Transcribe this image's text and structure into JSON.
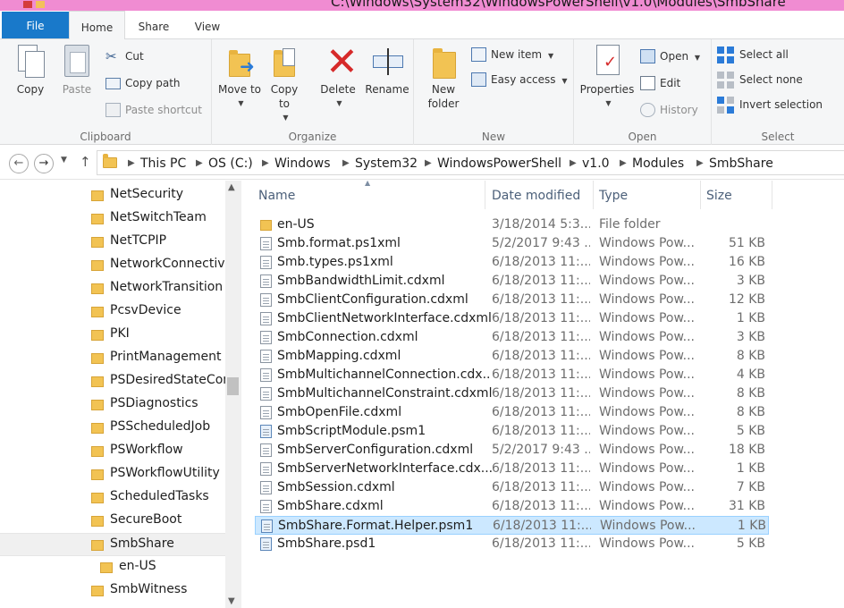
{
  "window": {
    "title": "C:\\Windows\\System32\\WindowsPowerShell\\v1.0\\Modules\\SmbShare"
  },
  "ribbon_tabs": [
    "File",
    "Home",
    "Share",
    "View"
  ],
  "ribbon": {
    "clipboard": {
      "label": "Clipboard",
      "copy": "Copy",
      "paste": "Paste",
      "cut": "Cut",
      "copy_path": "Copy path",
      "paste_shortcut": "Paste shortcut"
    },
    "organize": {
      "label": "Organize",
      "move_to": "Move to",
      "copy_to": "Copy to",
      "delete": "Delete",
      "rename": "Rename"
    },
    "new": {
      "label": "New",
      "new_folder": "New folder",
      "new_item": "New item",
      "easy_access": "Easy access"
    },
    "open": {
      "label": "Open",
      "properties": "Properties",
      "open": "Open",
      "edit": "Edit",
      "history": "History"
    },
    "select": {
      "label": "Select",
      "select_all": "Select all",
      "select_none": "Select none",
      "invert_selection": "Invert selection"
    }
  },
  "address": {
    "crumbs": [
      "This PC",
      "OS (C:)",
      "Windows",
      "System32",
      "WindowsPowerShell",
      "v1.0",
      "Modules",
      "SmbShare"
    ]
  },
  "nav_tree": [
    {
      "label": "NetSecurity"
    },
    {
      "label": "NetSwitchTeam"
    },
    {
      "label": "NetTCPIP"
    },
    {
      "label": "NetworkConnectivit"
    },
    {
      "label": "NetworkTransition"
    },
    {
      "label": "PcsvDevice"
    },
    {
      "label": "PKI"
    },
    {
      "label": "PrintManagement"
    },
    {
      "label": "PSDesiredStateCon"
    },
    {
      "label": "PSDiagnostics"
    },
    {
      "label": "PSScheduledJob"
    },
    {
      "label": "PSWorkflow"
    },
    {
      "label": "PSWorkflowUtility"
    },
    {
      "label": "ScheduledTasks"
    },
    {
      "label": "SecureBoot"
    },
    {
      "label": "SmbShare"
    },
    {
      "label": "en-US"
    },
    {
      "label": "SmbWitness"
    }
  ],
  "columns": {
    "name": "Name",
    "date": "Date modified",
    "type": "Type",
    "size": "Size"
  },
  "files": [
    {
      "name": "en-US",
      "date": "3/18/2014 5:3...",
      "type": "File folder",
      "size": "",
      "icon": "folder-icon"
    },
    {
      "name": "Smb.format.ps1xml",
      "date": "5/2/2017 9:43 ...",
      "type": "Windows Pow...",
      "size": "51 KB",
      "icon": "file-icon"
    },
    {
      "name": "Smb.types.ps1xml",
      "date": "6/18/2013 11:...",
      "type": "Windows Pow...",
      "size": "16 KB",
      "icon": "file-icon"
    },
    {
      "name": "SmbBandwidthLimit.cdxml",
      "date": "6/18/2013 11:...",
      "type": "Windows Pow...",
      "size": "3 KB",
      "icon": "file-icon"
    },
    {
      "name": "SmbClientConfiguration.cdxml",
      "date": "6/18/2013 11:...",
      "type": "Windows Pow...",
      "size": "12 KB",
      "icon": "file-icon"
    },
    {
      "name": "SmbClientNetworkInterface.cdxml",
      "date": "6/18/2013 11:...",
      "type": "Windows Pow...",
      "size": "1 KB",
      "icon": "file-icon"
    },
    {
      "name": "SmbConnection.cdxml",
      "date": "6/18/2013 11:...",
      "type": "Windows Pow...",
      "size": "3 KB",
      "icon": "file-icon"
    },
    {
      "name": "SmbMapping.cdxml",
      "date": "6/18/2013 11:...",
      "type": "Windows Pow...",
      "size": "8 KB",
      "icon": "file-icon"
    },
    {
      "name": "SmbMultichannelConnection.cdx...",
      "date": "6/18/2013 11:...",
      "type": "Windows Pow...",
      "size": "4 KB",
      "icon": "file-icon"
    },
    {
      "name": "SmbMultichannelConstraint.cdxml",
      "date": "6/18/2013 11:...",
      "type": "Windows Pow...",
      "size": "8 KB",
      "icon": "file-icon"
    },
    {
      "name": "SmbOpenFile.cdxml",
      "date": "6/18/2013 11:...",
      "type": "Windows Pow...",
      "size": "8 KB",
      "icon": "file-icon"
    },
    {
      "name": "SmbScriptModule.psm1",
      "date": "6/18/2013 11:...",
      "type": "Windows Pow...",
      "size": "5 KB",
      "icon": "script-icon"
    },
    {
      "name": "SmbServerConfiguration.cdxml",
      "date": "5/2/2017 9:43 ...",
      "type": "Windows Pow...",
      "size": "18 KB",
      "icon": "file-icon"
    },
    {
      "name": "SmbServerNetworkInterface.cdx...",
      "date": "6/18/2013 11:...",
      "type": "Windows Pow...",
      "size": "1 KB",
      "icon": "file-icon"
    },
    {
      "name": "SmbSession.cdxml",
      "date": "6/18/2013 11:...",
      "type": "Windows Pow...",
      "size": "7 KB",
      "icon": "file-icon"
    },
    {
      "name": "SmbShare.cdxml",
      "date": "6/18/2013 11:...",
      "type": "Windows Pow...",
      "size": "31 KB",
      "icon": "file-icon"
    },
    {
      "name": "SmbShare.Format.Helper.psm1",
      "date": "6/18/2013 11:...",
      "type": "Windows Pow...",
      "size": "1 KB",
      "icon": "script-icon"
    },
    {
      "name": "SmbShare.psd1",
      "date": "6/18/2013 11:...",
      "type": "Windows Pow...",
      "size": "5 KB",
      "icon": "script-icon"
    }
  ],
  "colors": {
    "file_tab": "#1979ca",
    "title_strip": "#f08cd2",
    "selection_bg": "#cce8ff",
    "selection_border": "#99d1ff",
    "folder": "#f2c353"
  }
}
